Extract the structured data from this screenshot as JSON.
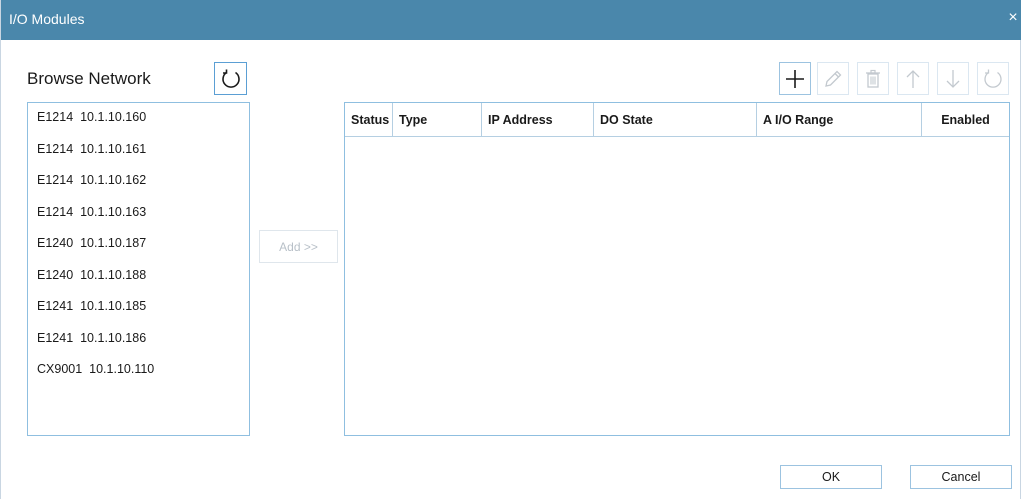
{
  "window": {
    "title": "I/O Modules",
    "close_glyph": "×"
  },
  "browse": {
    "label": "Browse Network",
    "refresh_icon": "refresh-icon",
    "items": [
      {
        "model": "E1214",
        "ip": "10.1.10.160"
      },
      {
        "model": "E1214",
        "ip": "10.1.10.161"
      },
      {
        "model": "E1214",
        "ip": "10.1.10.162"
      },
      {
        "model": "E1214",
        "ip": "10.1.10.163"
      },
      {
        "model": "E1240",
        "ip": "10.1.10.187"
      },
      {
        "model": "E1240",
        "ip": "10.1.10.188"
      },
      {
        "model": "E1241",
        "ip": "10.1.10.185"
      },
      {
        "model": "E1241",
        "ip": "10.1.10.186"
      },
      {
        "model": "CX9001",
        "ip": "10.1.10.110"
      }
    ]
  },
  "add_button": {
    "label": "Add >>",
    "enabled": false
  },
  "toolbar": {
    "icons": [
      "plus-icon",
      "pencil-icon",
      "trash-icon",
      "arrow-up-icon",
      "arrow-down-icon",
      "refresh-icon"
    ]
  },
  "table": {
    "columns": [
      "Status",
      "Type",
      "IP Address",
      "DO State",
      "A I/O Range",
      "Enabled"
    ],
    "rows": []
  },
  "footer": {
    "ok_label": "OK",
    "cancel_label": "Cancel"
  },
  "colors": {
    "titlebar": "#4a87ab",
    "border": "#8fbfe0",
    "accent": "#5b9fd4"
  }
}
